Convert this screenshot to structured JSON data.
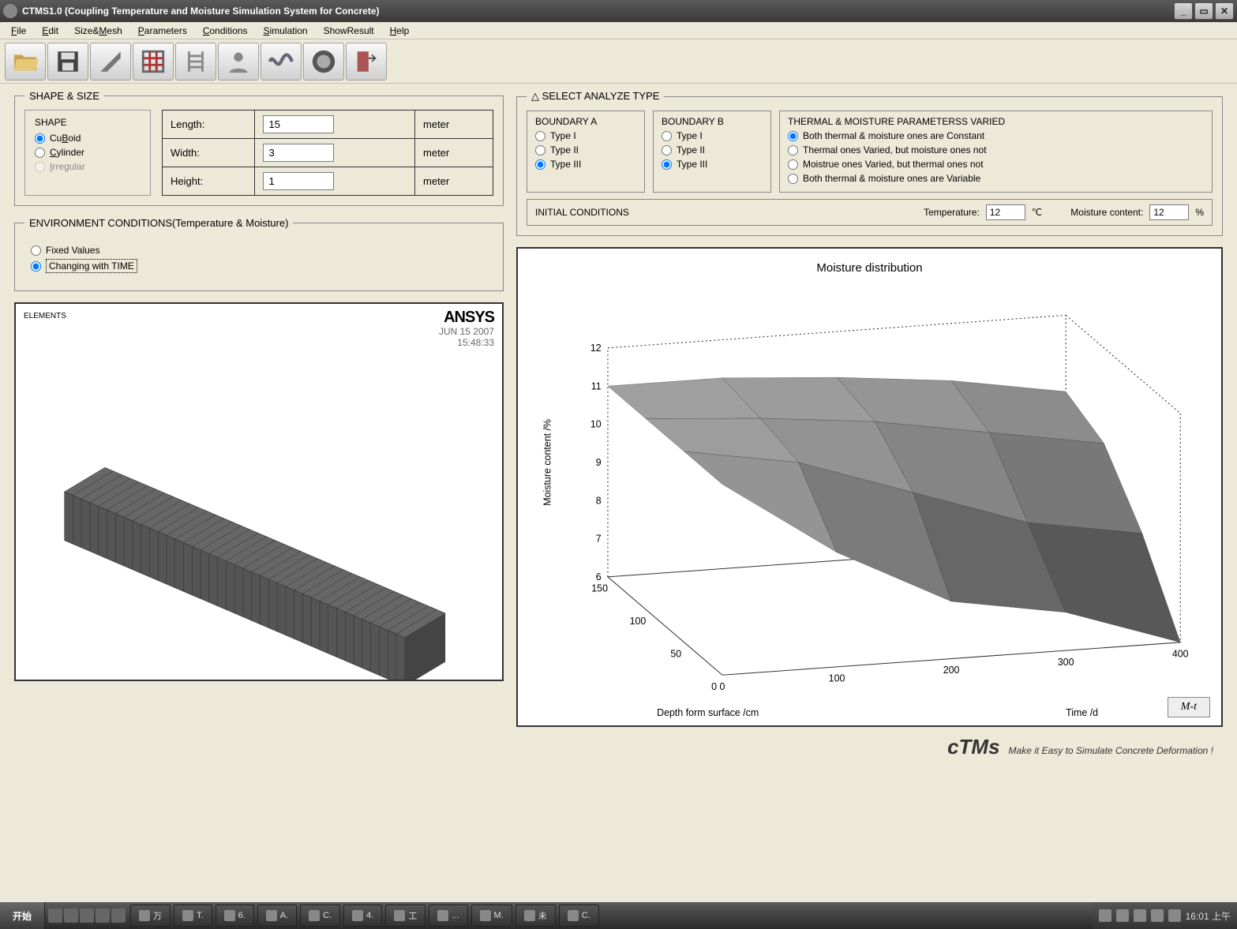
{
  "window": {
    "title": "CTMS1.0 (Coupling Temperature and Moisture Simulation System for Concrete)"
  },
  "menu": [
    "File",
    "Edit",
    "Size&Mesh",
    "Parameters",
    "Conditions",
    "Simulation",
    "ShowResult",
    "Help"
  ],
  "shape_size": {
    "legend": "SHAPE & SIZE",
    "shape_label": "SHAPE",
    "options": {
      "cuboid": "CuBoid",
      "cylinder": "Cylinder",
      "irregular": "Irregular"
    },
    "dims": {
      "length_label": "Length:",
      "length_val": "15",
      "length_unit": "meter",
      "width_label": "Width:",
      "width_val": "3",
      "width_unit": "meter",
      "height_label": "Height:",
      "height_val": "1",
      "height_unit": "meter"
    }
  },
  "env": {
    "legend": "ENVIRONMENT CONDITIONS(Temperature & Moisture)",
    "fixed": "Fixed Values",
    "changing": "Changing with TIME"
  },
  "mesh_image": {
    "elements": "ELEMENTS",
    "logo": "ANSYS",
    "date": "JUN 15 2007",
    "time": "15:48:33"
  },
  "analyze": {
    "legend": "△ SELECT ANALYZE TYPE",
    "boundary_a": "BOUNDARY A",
    "boundary_b": "BOUNDARY B",
    "t1": "Type I",
    "t2": "Type II",
    "t3": "Type III",
    "params_label": "THERMAL & MOISTURE PARAMETERSS VARIED",
    "p1": "Both thermal & moisture ones are Constant",
    "p2": "Thermal ones Varied, but moisture ones not",
    "p3": "Moistrue ones Varied, but thermal ones not",
    "p4": "Both thermal & moisture ones are Variable",
    "initial_label": "INITIAL CONDITIONS",
    "temp_label": "Temperature:",
    "temp_val": "12",
    "temp_unit": "℃",
    "moist_label": "Moisture content:",
    "moist_val": "12",
    "moist_unit": "%"
  },
  "plot": {
    "title": "Moisture distribution",
    "zlabel": "Moisture content /%",
    "xlabel": "Depth form surface /cm",
    "ylabel": "Time /d",
    "zticks": [
      "6",
      "7",
      "8",
      "9",
      "10",
      "11",
      "12"
    ],
    "xticks": [
      "0",
      "50",
      "100",
      "150"
    ],
    "yticks": [
      "0",
      "100",
      "200",
      "300",
      "400"
    ],
    "button": "M-t"
  },
  "tagline_prefix": "cTMs",
  "tagline": "Make it Easy to Simulate Concrete Deformation !",
  "taskbar": {
    "start": "开始",
    "items": [
      "万",
      "T.",
      "6.",
      "A.",
      "C.",
      "4.",
      "工",
      "...",
      "M.",
      "未",
      "C."
    ],
    "clock": "16:01 上午"
  },
  "chart_data": {
    "type": "surface-3d",
    "title": "Moisture distribution",
    "x_axis": {
      "label": "Depth form surface /cm",
      "range": [
        0,
        150
      ],
      "ticks": [
        0,
        50,
        100,
        150
      ]
    },
    "y_axis": {
      "label": "Time /d",
      "range": [
        0,
        400
      ],
      "ticks": [
        0,
        100,
        200,
        300,
        400
      ]
    },
    "z_axis": {
      "label": "Moisture content /%",
      "range": [
        6,
        12
      ],
      "ticks": [
        6,
        7,
        8,
        9,
        10,
        11,
        12
      ]
    },
    "grid_x": [
      0,
      50,
      100,
      150
    ],
    "grid_y": [
      0,
      100,
      200,
      300,
      400
    ],
    "z_values": [
      [
        11.0,
        11.0,
        11.0,
        11.0
      ],
      [
        9.0,
        10.5,
        10.8,
        11.0
      ],
      [
        7.5,
        9.5,
        10.5,
        10.8
      ],
      [
        7.0,
        8.5,
        10.0,
        10.5
      ],
      [
        6.0,
        8.0,
        9.5,
        10.0
      ]
    ],
    "note": "z_values[iy][ix] ≈ moisture % at (grid_x[ix], grid_y[iy]); values estimated from figure"
  }
}
